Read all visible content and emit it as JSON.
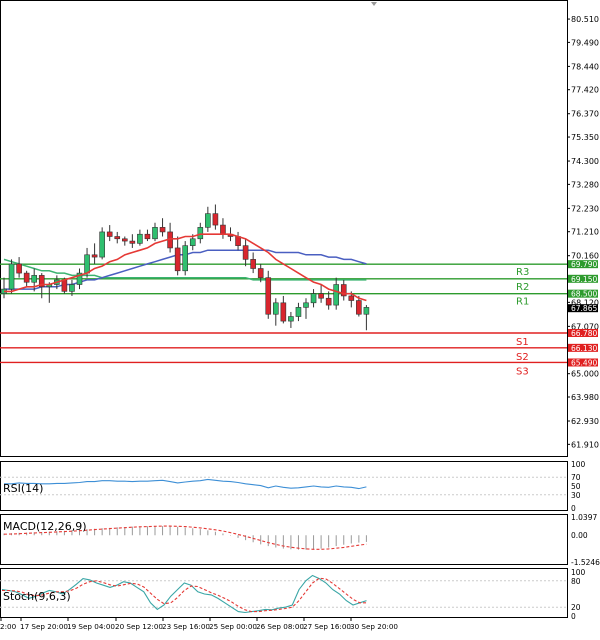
{
  "chart_data": {
    "type": "candlestick",
    "main": {
      "price_axis_ticks": [
        "80.510",
        "79.490",
        "78.440",
        "77.420",
        "76.370",
        "75.350",
        "74.300",
        "73.280",
        "72.230",
        "71.210",
        "70.160",
        "68.120",
        "67.070",
        "65.000",
        "63.980",
        "62.930",
        "61.910"
      ],
      "time_ticks": [
        "2:00",
        "17 Sep 20:00",
        "19 Sep 04:00",
        "20 Sep 12:00",
        "23 Sep 16:00",
        "25 Sep 00:00",
        "26 Sep 08:00",
        "27 Sep 16:00",
        "30 Sep 20:00"
      ],
      "ylim": [
        61.4,
        81.3
      ],
      "candles": [
        {
          "o": 68.5,
          "h": 69.2,
          "l": 68.3,
          "c": 68.7
        },
        {
          "o": 68.7,
          "h": 70.0,
          "l": 68.5,
          "c": 69.8
        },
        {
          "o": 69.8,
          "h": 70.1,
          "l": 69.2,
          "c": 69.4
        },
        {
          "o": 69.4,
          "h": 69.5,
          "l": 68.8,
          "c": 69.0
        },
        {
          "o": 69.0,
          "h": 69.6,
          "l": 68.6,
          "c": 69.3
        },
        {
          "o": 69.3,
          "h": 69.4,
          "l": 68.3,
          "c": 68.8
        },
        {
          "o": 68.8,
          "h": 69.0,
          "l": 68.1,
          "c": 68.9
        },
        {
          "o": 68.9,
          "h": 69.3,
          "l": 68.7,
          "c": 69.1
        },
        {
          "o": 69.1,
          "h": 69.2,
          "l": 68.5,
          "c": 68.6
        },
        {
          "o": 68.6,
          "h": 69.1,
          "l": 68.4,
          "c": 68.9
        },
        {
          "o": 68.9,
          "h": 69.6,
          "l": 68.7,
          "c": 69.4
        },
        {
          "o": 69.4,
          "h": 70.5,
          "l": 69.2,
          "c": 70.2
        },
        {
          "o": 70.2,
          "h": 70.7,
          "l": 69.8,
          "c": 70.1
        },
        {
          "o": 70.1,
          "h": 71.4,
          "l": 70.0,
          "c": 71.2
        },
        {
          "o": 71.2,
          "h": 71.5,
          "l": 70.8,
          "c": 71.0
        },
        {
          "o": 71.0,
          "h": 71.2,
          "l": 70.7,
          "c": 70.9
        },
        {
          "o": 70.9,
          "h": 71.0,
          "l": 70.6,
          "c": 70.8
        },
        {
          "o": 70.8,
          "h": 71.1,
          "l": 70.5,
          "c": 70.7
        },
        {
          "o": 70.7,
          "h": 71.3,
          "l": 70.6,
          "c": 71.1
        },
        {
          "o": 71.1,
          "h": 71.3,
          "l": 70.8,
          "c": 70.9
        },
        {
          "o": 70.9,
          "h": 71.6,
          "l": 70.8,
          "c": 71.4
        },
        {
          "o": 71.4,
          "h": 71.8,
          "l": 71.0,
          "c": 71.2
        },
        {
          "o": 71.2,
          "h": 71.6,
          "l": 70.3,
          "c": 70.5
        },
        {
          "o": 70.5,
          "h": 71.0,
          "l": 69.3,
          "c": 69.5
        },
        {
          "o": 69.5,
          "h": 70.8,
          "l": 69.3,
          "c": 70.6
        },
        {
          "o": 70.6,
          "h": 71.1,
          "l": 70.4,
          "c": 70.9
        },
        {
          "o": 70.9,
          "h": 71.6,
          "l": 70.7,
          "c": 71.4
        },
        {
          "o": 71.4,
          "h": 72.3,
          "l": 71.2,
          "c": 72.0
        },
        {
          "o": 72.0,
          "h": 72.4,
          "l": 71.3,
          "c": 71.5
        },
        {
          "o": 71.5,
          "h": 71.8,
          "l": 70.9,
          "c": 71.1
        },
        {
          "o": 71.1,
          "h": 71.4,
          "l": 70.8,
          "c": 71.0
        },
        {
          "o": 71.0,
          "h": 71.2,
          "l": 70.4,
          "c": 70.6
        },
        {
          "o": 70.6,
          "h": 70.9,
          "l": 69.7,
          "c": 70.0
        },
        {
          "o": 70.0,
          "h": 70.3,
          "l": 69.4,
          "c": 69.6
        },
        {
          "o": 69.6,
          "h": 69.8,
          "l": 69.0,
          "c": 69.2
        },
        {
          "o": 69.2,
          "h": 69.5,
          "l": 67.4,
          "c": 67.6
        },
        {
          "o": 67.6,
          "h": 68.3,
          "l": 67.1,
          "c": 68.1
        },
        {
          "o": 68.1,
          "h": 68.4,
          "l": 67.2,
          "c": 67.3
        },
        {
          "o": 67.3,
          "h": 67.7,
          "l": 67.0,
          "c": 67.5
        },
        {
          "o": 67.5,
          "h": 68.1,
          "l": 67.3,
          "c": 67.9
        },
        {
          "o": 67.9,
          "h": 68.3,
          "l": 67.4,
          "c": 68.1
        },
        {
          "o": 68.1,
          "h": 68.7,
          "l": 67.9,
          "c": 68.5
        },
        {
          "o": 68.5,
          "h": 68.9,
          "l": 68.1,
          "c": 68.3
        },
        {
          "o": 68.3,
          "h": 68.6,
          "l": 67.8,
          "c": 68.0
        },
        {
          "o": 68.0,
          "h": 69.2,
          "l": 67.8,
          "c": 68.9
        },
        {
          "o": 68.9,
          "h": 69.1,
          "l": 68.2,
          "c": 68.4
        },
        {
          "o": 68.4,
          "h": 68.6,
          "l": 67.9,
          "c": 68.2
        },
        {
          "o": 68.2,
          "h": 68.4,
          "l": 67.5,
          "c": 67.6
        },
        {
          "o": 67.6,
          "h": 68.0,
          "l": 66.9,
          "c": 67.9
        }
      ],
      "ma_fast": [
        68.6,
        68.6,
        68.7,
        68.8,
        68.8,
        68.9,
        68.9,
        69.0,
        69.1,
        69.2,
        69.3,
        69.4,
        69.6,
        69.7,
        69.9,
        70.0,
        70.2,
        70.3,
        70.4,
        70.5,
        70.7,
        70.8,
        70.9,
        70.9,
        71.0,
        71.0,
        71.1,
        71.1,
        71.1,
        71.1,
        71.1,
        71.0,
        70.9,
        70.7,
        70.5,
        70.3,
        70.0,
        69.8,
        69.6,
        69.4,
        69.2,
        69.0,
        68.9,
        68.7,
        68.6,
        68.5,
        68.5,
        68.3,
        68.2
      ],
      "ma_mid": [
        70.0,
        69.9,
        69.8,
        69.7,
        69.6,
        69.5,
        69.5,
        69.4,
        69.4,
        69.3,
        69.3,
        69.3,
        69.3,
        69.2,
        69.2,
        69.2,
        69.2,
        69.2,
        69.2,
        69.2,
        69.2,
        69.2,
        69.2,
        69.2,
        69.2,
        69.2,
        69.2,
        69.2,
        69.2,
        69.2,
        69.2,
        69.2,
        69.2,
        69.1,
        69.1,
        69.1,
        69.1,
        69.1,
        69.1,
        69.1,
        69.1,
        69.1,
        69.1,
        69.1,
        69.1,
        69.1,
        69.1,
        69.1,
        69.1
      ],
      "ma_slow": [
        68.7,
        68.7,
        68.7,
        68.7,
        68.7,
        68.8,
        68.8,
        68.8,
        68.9,
        68.9,
        69.0,
        69.1,
        69.1,
        69.2,
        69.3,
        69.4,
        69.5,
        69.6,
        69.7,
        69.8,
        69.9,
        70.0,
        70.1,
        70.2,
        70.2,
        70.3,
        70.3,
        70.4,
        70.4,
        70.4,
        70.4,
        70.4,
        70.4,
        70.4,
        70.4,
        70.4,
        70.3,
        70.3,
        70.3,
        70.3,
        70.2,
        70.2,
        70.2,
        70.1,
        70.1,
        70.0,
        70.0,
        69.9,
        69.8
      ],
      "levels": [
        {
          "name": "R3",
          "value": 69.79,
          "label": "69.790",
          "color": "#2e9b2e"
        },
        {
          "name": "R2",
          "value": 69.15,
          "label": "69.150",
          "color": "#2e9b2e"
        },
        {
          "name": "R1",
          "value": 68.5,
          "label": "68.500",
          "color": "#2e9b2e"
        },
        {
          "name": "S1",
          "value": 66.78,
          "label": "66.780",
          "color": "#e02020"
        },
        {
          "name": "S2",
          "value": 66.13,
          "label": "66.130",
          "color": "#e02020"
        },
        {
          "name": "S3",
          "value": 65.49,
          "label": "65.490",
          "color": "#e02020"
        }
      ],
      "current_price": {
        "value": 67.865,
        "label": "67.865"
      }
    },
    "rsi": {
      "label": "RSI(14)",
      "ticks": [
        "100",
        "70",
        "50",
        "30",
        "0"
      ],
      "values": [
        55,
        55,
        57,
        56,
        56,
        55,
        55,
        56,
        56,
        57,
        58,
        60,
        60,
        62,
        62,
        61,
        61,
        60,
        61,
        61,
        62,
        63,
        60,
        57,
        59,
        61,
        62,
        65,
        63,
        61,
        60,
        58,
        55,
        53,
        51,
        46,
        50,
        47,
        45,
        46,
        48,
        50,
        48,
        47,
        50,
        48,
        47,
        44,
        48
      ]
    },
    "macd": {
      "label": "MACD(12,26,9)",
      "ticks": [
        "1.0397",
        "0.00",
        "-1.5246"
      ],
      "hist": [
        0.1,
        0.12,
        0.14,
        0.15,
        0.17,
        0.18,
        0.2,
        0.22,
        0.25,
        0.28,
        0.31,
        0.34,
        0.37,
        0.4,
        0.42,
        0.45,
        0.47,
        0.49,
        0.5,
        0.51,
        0.52,
        0.52,
        0.51,
        0.48,
        0.44,
        0.4,
        0.35,
        0.28,
        0.2,
        0.1,
        -0.02,
        -0.15,
        -0.28,
        -0.4,
        -0.52,
        -0.62,
        -0.7,
        -0.76,
        -0.8,
        -0.82,
        -0.82,
        -0.8,
        -0.76,
        -0.7,
        -0.62,
        -0.54,
        -0.47,
        -0.42,
        -0.38
      ],
      "signal": [
        0.06,
        0.07,
        0.09,
        0.11,
        0.13,
        0.15,
        0.17,
        0.19,
        0.21,
        0.23,
        0.26,
        0.29,
        0.32,
        0.35,
        0.38,
        0.41,
        0.43,
        0.46,
        0.48,
        0.49,
        0.51,
        0.52,
        0.52,
        0.51,
        0.49,
        0.46,
        0.42,
        0.37,
        0.31,
        0.24,
        0.15,
        0.05,
        -0.06,
        -0.18,
        -0.3,
        -0.42,
        -0.52,
        -0.61,
        -0.68,
        -0.74,
        -0.78,
        -0.8,
        -0.8,
        -0.78,
        -0.74,
        -0.69,
        -0.63,
        -0.57,
        -0.51
      ]
    },
    "stoch": {
      "label": "Stoch(9,6,3)",
      "ticks": [
        "100",
        "80",
        "20",
        "0"
      ],
      "k": [
        60,
        58,
        55,
        48,
        40,
        45,
        52,
        58,
        55,
        50,
        60,
        72,
        85,
        82,
        75,
        70,
        65,
        70,
        78,
        75,
        65,
        55,
        30,
        15,
        25,
        45,
        60,
        75,
        70,
        55,
        50,
        48,
        40,
        30,
        20,
        10,
        8,
        10,
        12,
        15,
        14,
        18,
        20,
        25,
        60,
        80,
        92,
        85,
        75,
        60,
        50,
        35,
        25,
        30,
        35
      ],
      "d": [
        58,
        58,
        57,
        54,
        48,
        46,
        48,
        52,
        55,
        55,
        57,
        63,
        72,
        78,
        80,
        76,
        71,
        68,
        71,
        74,
        73,
        66,
        52,
        38,
        28,
        30,
        42,
        58,
        68,
        67,
        60,
        53,
        47,
        40,
        32,
        22,
        14,
        10,
        10,
        12,
        13,
        15,
        17,
        20,
        35,
        55,
        75,
        86,
        84,
        74,
        62,
        50,
        38,
        30,
        30
      ]
    }
  }
}
